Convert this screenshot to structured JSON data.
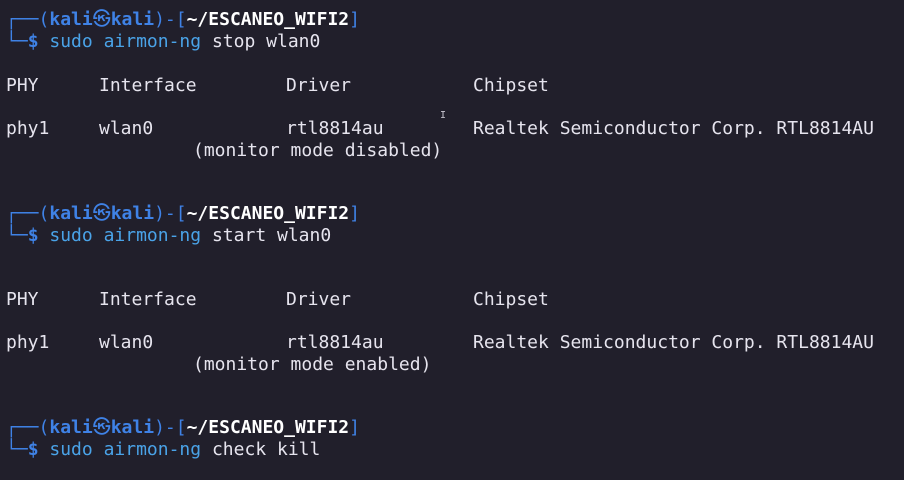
{
  "prompt": {
    "user": "kali",
    "host": "kali",
    "at_symbol": "㉿",
    "path": "~/ESCANEO_WIFI2",
    "dollar": "$"
  },
  "blocks": [
    {
      "cmd_sudo": "sudo",
      "cmd_prog": "airmon-ng",
      "cmd_args": "stop wlan0",
      "headers": [
        "PHY",
        "Interface",
        "Driver",
        "Chipset"
      ],
      "row": [
        "phy1",
        "wlan0",
        "rtl8814au",
        "Realtek Semiconductor Corp. RTL8814AU"
      ],
      "note": "(monitor mode disabled)"
    },
    {
      "cmd_sudo": "sudo",
      "cmd_prog": "airmon-ng",
      "cmd_args": "start wlan0",
      "headers": [
        "PHY",
        "Interface",
        "Driver",
        "Chipset"
      ],
      "row": [
        "phy1",
        "wlan0",
        "rtl8814au",
        "Realtek Semiconductor Corp. RTL8814AU"
      ],
      "note": "(monitor mode enabled)"
    },
    {
      "cmd_sudo": "sudo",
      "cmd_prog": "airmon-ng",
      "cmd_args": "check kill"
    }
  ]
}
